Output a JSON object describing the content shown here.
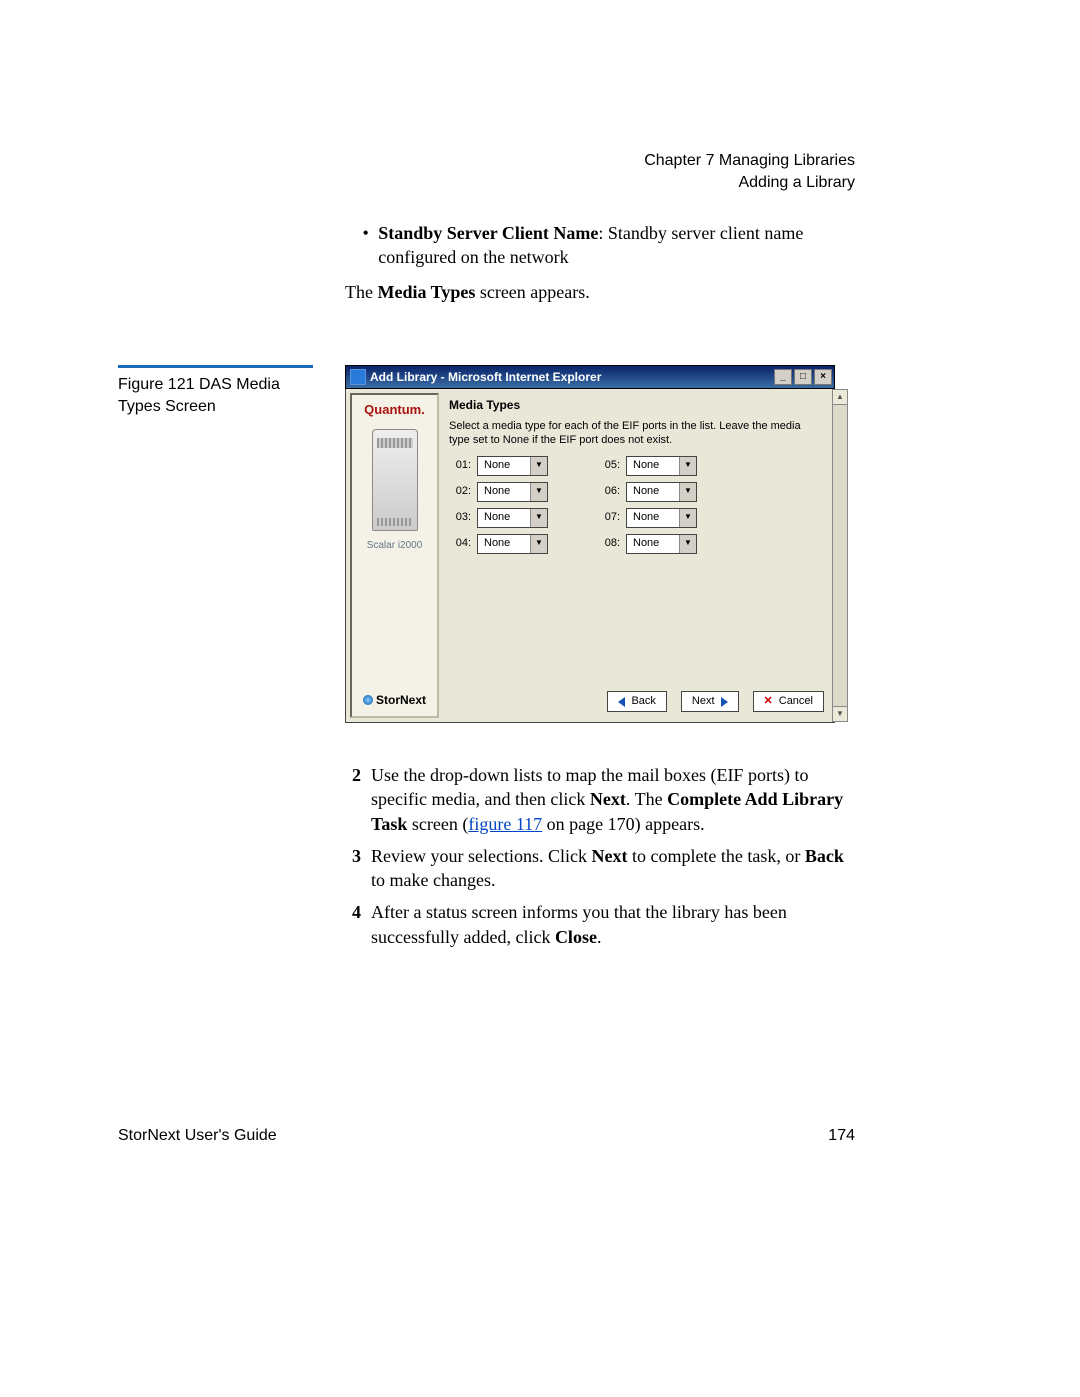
{
  "header": {
    "chapter": "Chapter 7  Managing Libraries",
    "section": "Adding a Library"
  },
  "bullet": {
    "lead_bold": "Standby Server Client Name",
    "rest": ": Standby server client name configured on the network"
  },
  "para_media": {
    "pre": "The ",
    "bold": "Media Types",
    "post": " screen appears."
  },
  "figure_caption": "Figure 121  DAS Media Types Screen",
  "window": {
    "title": "Add Library - Microsoft Internet Explorer",
    "min": "_",
    "max": "□",
    "close": "×",
    "sidebar": {
      "brand": "Quantum.",
      "model": "Scalar i2000",
      "product": "StorNext"
    },
    "heading": "Media Types",
    "desc": "Select a media type for each of the EIF ports in the list. Leave the media type set to None if the EIF port does not exist.",
    "ports_left": [
      {
        "label": "01:",
        "value": "None"
      },
      {
        "label": "02:",
        "value": "None"
      },
      {
        "label": "03:",
        "value": "None"
      },
      {
        "label": "04:",
        "value": "None"
      }
    ],
    "ports_right": [
      {
        "label": "05:",
        "value": "None"
      },
      {
        "label": "06:",
        "value": "None"
      },
      {
        "label": "07:",
        "value": "None"
      },
      {
        "label": "08:",
        "value": "None"
      }
    ],
    "buttons": {
      "back": "Back",
      "next": "Next",
      "cancel": "Cancel"
    },
    "scroll_up": "▲",
    "scroll_dn": "▼",
    "dd_arrow": "▼"
  },
  "steps": {
    "s2": {
      "num": "2",
      "a": "Use the drop-down lists to map the mail boxes (EIF ports) to specific media, and then click ",
      "b": "Next",
      "c": ". The ",
      "d": "Complete Add Library Task",
      "e": " screen (",
      "link": "figure 117",
      "f": " on page 170) appears."
    },
    "s3": {
      "num": "3",
      "a": "Review your selections. Click ",
      "b": "Next",
      "c": " to complete the task, or ",
      "d": "Back",
      "e": " to make changes."
    },
    "s4": {
      "num": "4",
      "a": "After a status screen informs you that the library has been successfully added, click ",
      "b": "Close",
      "c": "."
    }
  },
  "footer": {
    "guide": "StorNext User's Guide",
    "page": "174"
  }
}
